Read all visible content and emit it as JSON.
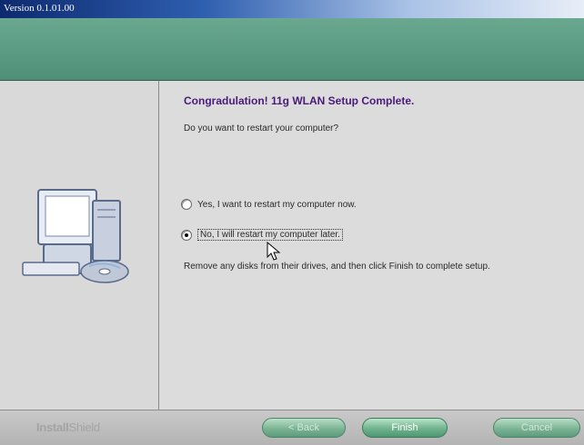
{
  "window": {
    "title": "Version 0.1.01.00"
  },
  "content": {
    "heading": "Congradulation! 11g WLAN Setup Complete.",
    "question": "Do you want to restart your computer?",
    "options": [
      {
        "label": "Yes, I want to restart my computer now.",
        "selected": false
      },
      {
        "label": "No, I will restart my computer later.",
        "selected": true
      }
    ],
    "note": "Remove any disks from their drives, and then click Finish to complete setup."
  },
  "footer": {
    "brand_bold": "Install",
    "brand_thin": "Shield",
    "back_label": "< Back",
    "finish_label": "Finish",
    "cancel_label": "Cancel"
  },
  "colors": {
    "banner": "#5f9f86",
    "heading": "#4a1a7a",
    "button": "#6fb38d"
  },
  "icons": [
    "computer-illustration",
    "cd-disk-icon",
    "mouse-cursor-icon"
  ]
}
